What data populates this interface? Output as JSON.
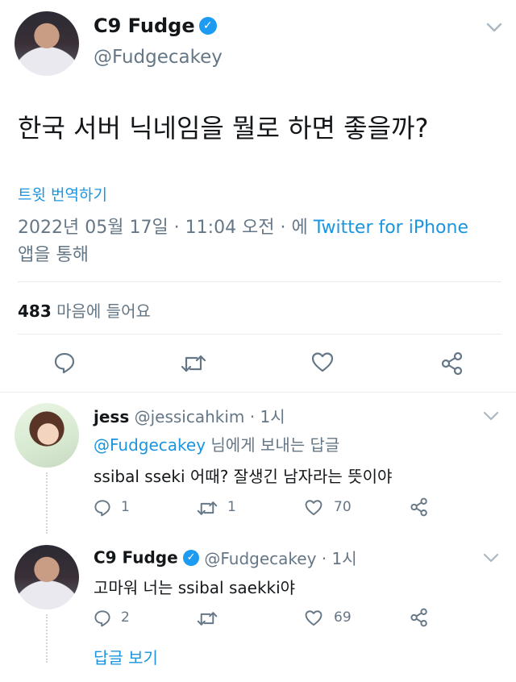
{
  "main_tweet": {
    "display_name": "C9 Fudge",
    "handle": "@Fudgecakey",
    "text": "한국 서버 닉네임을 뭘로 하면 좋을까?",
    "translate_label": "트윗 번역하기",
    "timestamp_line1_prefix": "2022년 05월 17일 · 11:04 오전 · 에 ",
    "timestamp_source": "Twitter for iPhone",
    "timestamp_line2": "앱을 통해",
    "likes_count": "483",
    "likes_label": "마음에 들어요"
  },
  "replies": [
    {
      "display_name": "jess",
      "handle_time": "@jessicahkim · 1시",
      "reply_to_handle": "@Fudgecakey",
      "reply_to_suffix": " 님에게 보내는 답글",
      "text": "ssibal sseki 어때? 잘생긴 남자라는 뜻이야",
      "reply_count": "1",
      "retweet_count": "1",
      "like_count": "70"
    },
    {
      "display_name": "C9 Fudge",
      "handle_time": "@Fudgecakey · 1시",
      "text": "고마워 너는 ssibal saekki야",
      "reply_count": "2",
      "retweet_count": "",
      "like_count": "69"
    }
  ],
  "show_replies_label": "답글 보기",
  "icons": {
    "verified": "verified-badge-icon",
    "chevron": "chevron-down-icon",
    "reply": "reply-icon",
    "retweet": "retweet-icon",
    "like": "heart-icon",
    "share": "share-icon"
  },
  "colors": {
    "accent": "#1b95e0",
    "muted": "#657786",
    "text": "#14171a"
  }
}
